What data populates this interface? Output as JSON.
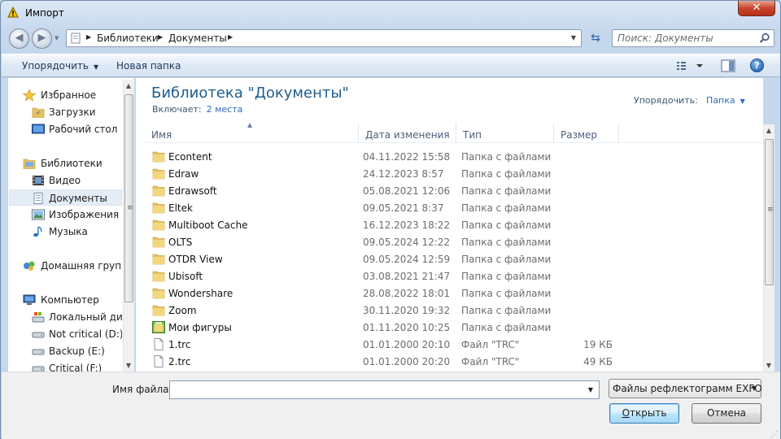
{
  "window": {
    "title": "Импорт",
    "close_glyph": "✕"
  },
  "address": {
    "crumbs": [
      "Библиотеки",
      "Документы"
    ],
    "search_placeholder": "Поиск: Документы"
  },
  "toolbar": {
    "organize": "Упорядочить",
    "new_folder": "Новая папка",
    "help": "?"
  },
  "nav": {
    "favorites": "Избранное",
    "downloads": "Загрузки",
    "desktop": "Рабочий стол",
    "libraries": "Библиотеки",
    "video": "Видео",
    "documents": "Документы",
    "images": "Изображения",
    "music": "Музыка",
    "homegroup": "Домашняя группа",
    "computer": "Компьютер",
    "local_disk": "Локальный диск",
    "drive_d": "Not critical (D:)",
    "drive_e": "Backup (E:)",
    "drive_f": "Critical (F:)"
  },
  "library": {
    "title": "Библиотека \"Документы\"",
    "includes_label": "Включает:",
    "includes_link": "2 места",
    "arrange_label": "Упорядочить:",
    "arrange_value": "Папка"
  },
  "columns": {
    "name": "Имя",
    "modified": "Дата изменения",
    "type": "Тип",
    "size": "Размер"
  },
  "files": [
    {
      "name": "Econtent",
      "modified": "04.11.2022 15:58",
      "type": "Папка с файлами",
      "size": "",
      "icon": "folder-icon"
    },
    {
      "name": "Edraw",
      "modified": "24.12.2023 8:57",
      "type": "Папка с файлами",
      "size": "",
      "icon": "folder-icon"
    },
    {
      "name": "Edrawsoft",
      "modified": "05.08.2021 12:06",
      "type": "Папка с файлами",
      "size": "",
      "icon": "folder-icon"
    },
    {
      "name": "Eltek",
      "modified": "09.05.2021 8:37",
      "type": "Папка с файлами",
      "size": "",
      "icon": "folder-icon"
    },
    {
      "name": "Multiboot Cache",
      "modified": "16.12.2023 18:22",
      "type": "Папка с файлами",
      "size": "",
      "icon": "folder-icon"
    },
    {
      "name": "OLTS",
      "modified": "09.05.2024 12:22",
      "type": "Папка с файлами",
      "size": "",
      "icon": "folder-icon"
    },
    {
      "name": "OTDR View",
      "modified": "09.05.2024 12:59",
      "type": "Папка с файлами",
      "size": "",
      "icon": "folder-icon"
    },
    {
      "name": "Ubisoft",
      "modified": "03.08.2021 21:47",
      "type": "Папка с файлами",
      "size": "",
      "icon": "folder-icon"
    },
    {
      "name": "Wondershare",
      "modified": "28.08.2022 18:01",
      "type": "Папка с файлами",
      "size": "",
      "icon": "folder-icon"
    },
    {
      "name": "Zoom",
      "modified": "30.11.2020 19:32",
      "type": "Папка с файлами",
      "size": "",
      "icon": "folder-icon"
    },
    {
      "name": "Мои фигуры",
      "modified": "01.11.2020 10:25",
      "type": "Папка с файлами",
      "size": "",
      "icon": "special-folder-icon"
    },
    {
      "name": "1.trc",
      "modified": "01.01.2000 20:10",
      "type": "Файл \"TRC\"",
      "size": "19 КБ",
      "icon": "file-icon"
    },
    {
      "name": "2.trc",
      "modified": "01.01.2000 20:20",
      "type": "Файл \"TRC\"",
      "size": "49 КБ",
      "icon": "file-icon"
    }
  ],
  "bottom": {
    "filename_label": "Имя файла:",
    "filename_value": "",
    "filter_value": "Файлы рефлектограмм EXFO",
    "open_hotkey": "О",
    "open_rest": "ткрыть",
    "cancel": "Отмена"
  },
  "colors": {
    "accent": "#1e5d8e",
    "link": "#2e6bbd",
    "folder": "#e8c25a"
  }
}
